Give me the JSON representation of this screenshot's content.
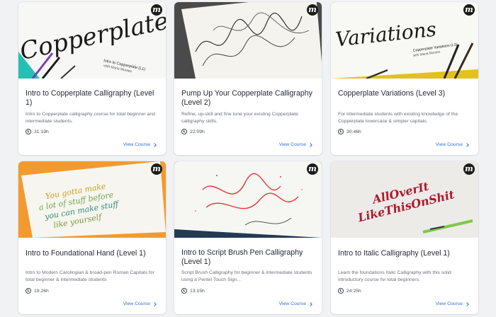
{
  "courses": [
    {
      "title": "Intro to Copperplate Calligraphy (Level 1)",
      "description": "Intro to Copperplate calligraphy course for total beginner and intermediate students.",
      "duration": "31:19h",
      "cta": "View Course",
      "thumb_text": "Copperplate",
      "thumb_sub": "Intro to Copperplate (L1)",
      "thumb_sub2": "with Maria Montes",
      "logo": "m"
    },
    {
      "title": "Pump Up Your Copperplate Calligraphy (Level 2)",
      "description": "Refine, up-skill and fine tune your existing Copperplate calligraphy skills.",
      "duration": "22:09h",
      "cta": "View Course",
      "logo": "m"
    },
    {
      "title": "Copperplate Variations (Level 3)",
      "description": "For intermediate students with existing knowledge of the Copperplate lowercase & simpler capitals.",
      "duration": "30:46h",
      "cta": "View Course",
      "thumb_text": "Variations",
      "thumb_sub": "Copperplate Variations (L3)",
      "thumb_sub2": "with Maria Montes",
      "logo": "m"
    },
    {
      "title": "Intro to Foundational Hand (Level 1)",
      "description": "Intro to Modern Carolingian & broad-pen Roman Capitals for total beginner & intermediate students",
      "duration": "19:26h",
      "cta": "View Course",
      "thumb_lines": [
        "You gotta make",
        "a lot of stuff before",
        "you can make stuff",
        "like yourself"
      ],
      "logo": "m"
    },
    {
      "title": "Intro to Script Brush Pen Calligraphy (Level 1)",
      "description": "Script Brush Calligraphy for beginner & intermediate students using a Pentel Touch Sign...",
      "duration": "13:15h",
      "cta": "View Course",
      "logo": "m"
    },
    {
      "title": "Intro to Italic Calligraphy (Level 1)",
      "description": "Learn the foundations Italic Calligraphy with this solid introductory course for total beginners.",
      "duration": "24:25h",
      "cta": "View Course",
      "thumb_lines": [
        "AllOverIt",
        "LikeThisOnShit"
      ],
      "logo": "m"
    }
  ],
  "colors": {
    "link": "#2f6fd1",
    "title": "#1f2937",
    "background": "#f1f2f4"
  }
}
